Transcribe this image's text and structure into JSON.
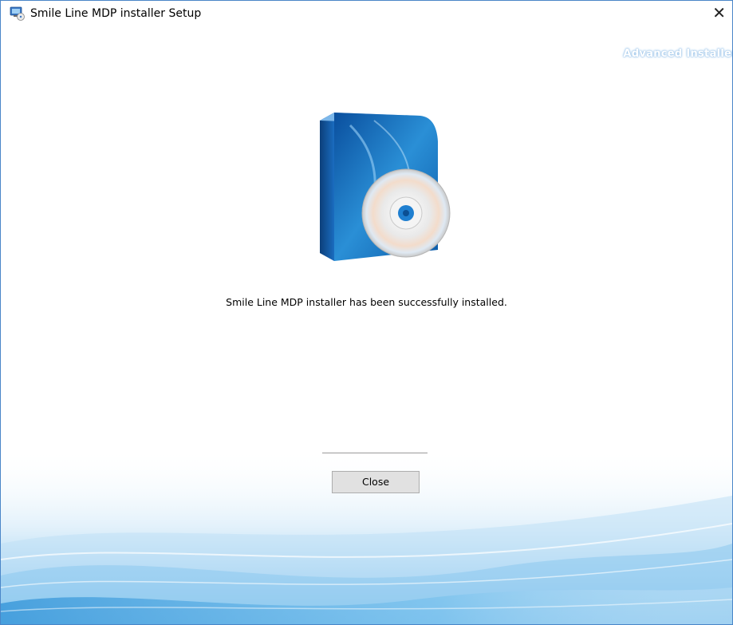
{
  "window": {
    "title": "Smile Line MDP installer Setup",
    "close_glyph": "✕",
    "brand": "Advanced Installer"
  },
  "main": {
    "message": "Smile Line MDP installer has been successfully installed.",
    "close_button_label": "Close"
  },
  "icons": {
    "app": "installer-app-icon",
    "product": "software-box-cd-icon"
  },
  "colors": {
    "window_border": "#4a86c8",
    "button_bg": "#e1e1e1",
    "button_border": "#adadad",
    "wave_blue": "#2a8fd6"
  }
}
